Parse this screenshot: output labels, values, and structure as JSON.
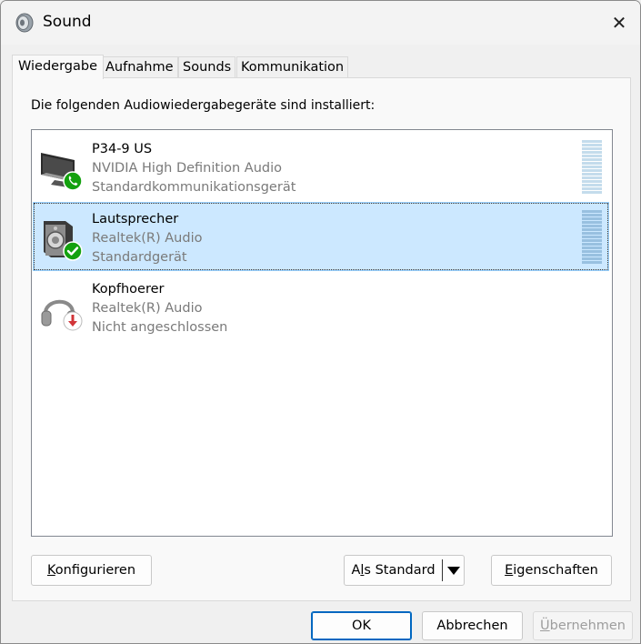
{
  "window": {
    "title": "Sound",
    "close_glyph": "✕"
  },
  "tabs": [
    {
      "label": "Wiedergabe",
      "active": true
    },
    {
      "label": "Aufnahme"
    },
    {
      "label": "Sounds"
    },
    {
      "label": "Kommunikation"
    }
  ],
  "panel": {
    "label": "Die folgenden Audiowiedergabegeräte sind installiert:"
  },
  "devices": [
    {
      "name": "P34-9 US",
      "driver": "NVIDIA High Definition Audio",
      "status": "Standardkommunikationsgerät",
      "icon": "monitor-icon",
      "badge": "phone-badge-icon"
    },
    {
      "name": "Lautsprecher",
      "driver": "Realtek(R) Audio",
      "status": "Standardgerät",
      "icon": "speaker-icon",
      "badge": "check-badge-icon",
      "selected": true
    },
    {
      "name": "Kopfhoerer",
      "driver": "Realtek(R) Audio",
      "status": "Nicht angeschlossen",
      "icon": "headphones-icon",
      "badge": "unplugged-badge-icon"
    }
  ],
  "buttons": {
    "configure": {
      "label_prefix": "",
      "accel": "K",
      "label_rest": "onfigurieren"
    },
    "set_default": {
      "label_prefix": "A",
      "accel": "l",
      "label_rest": "s Standard"
    },
    "properties": {
      "label_prefix": "",
      "accel": "E",
      "label_rest": "igenschaften"
    },
    "ok": "OK",
    "cancel": "Abbrechen",
    "apply": {
      "accel": "Ü",
      "label_rest": "bernehmen"
    }
  },
  "colors": {
    "selection_bg": "#cce8ff",
    "selection_border": "#99d1ff",
    "accent": "#0067c0",
    "badge_green": "#13a10e",
    "badge_red": "#d13438"
  }
}
